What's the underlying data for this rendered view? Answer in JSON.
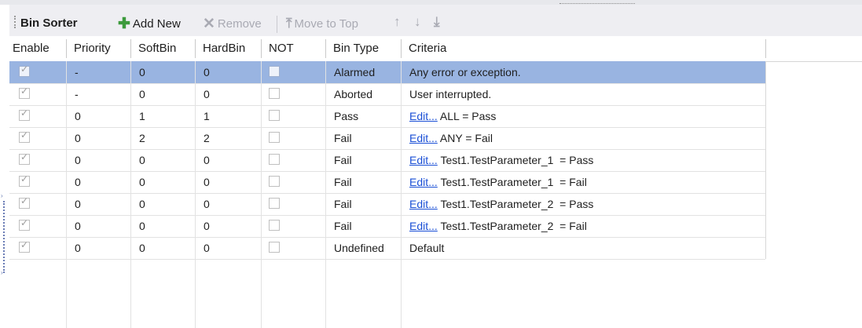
{
  "toolbar": {
    "title": "Bin Sorter",
    "add_new": "Add New",
    "remove": "Remove",
    "move_to_top": "Move to Top",
    "icons": [
      "plus-icon",
      "remove-x-icon",
      "move-to-top-icon",
      "move-up-icon",
      "move-down-icon",
      "move-to-bottom-icon"
    ]
  },
  "table": {
    "columns": [
      "Enable",
      "Priority",
      "SoftBin",
      "HardBin",
      "NOT",
      "Bin Type",
      "Criteria"
    ],
    "rows": [
      {
        "enable": true,
        "priority": "-",
        "softbin": "0",
        "hardbin": "0",
        "not": false,
        "bin_type": "Alarmed",
        "link": "",
        "criteria": "Any error or exception.",
        "selected": true
      },
      {
        "enable": true,
        "priority": "-",
        "softbin": "0",
        "hardbin": "0",
        "not": false,
        "bin_type": "Aborted",
        "link": "",
        "criteria": "User interrupted.",
        "selected": false
      },
      {
        "enable": true,
        "priority": "0",
        "softbin": "1",
        "hardbin": "1",
        "not": false,
        "bin_type": "Pass",
        "link": "Edit...",
        "criteria": "ALL = Pass",
        "selected": false
      },
      {
        "enable": true,
        "priority": "0",
        "softbin": "2",
        "hardbin": "2",
        "not": false,
        "bin_type": "Fail",
        "link": "Edit...",
        "criteria": "ANY = Fail",
        "selected": false
      },
      {
        "enable": true,
        "priority": "0",
        "softbin": "0",
        "hardbin": "0",
        "not": false,
        "bin_type": "Fail",
        "link": "Edit...",
        "criteria": "Test1.TestParameter_1  = Pass",
        "selected": false
      },
      {
        "enable": true,
        "priority": "0",
        "softbin": "0",
        "hardbin": "0",
        "not": false,
        "bin_type": "Fail",
        "link": "Edit...",
        "criteria": "Test1.TestParameter_1  = Fail",
        "selected": false
      },
      {
        "enable": true,
        "priority": "0",
        "softbin": "0",
        "hardbin": "0",
        "not": false,
        "bin_type": "Fail",
        "link": "Edit...",
        "criteria": "Test1.TestParameter_2  = Pass",
        "selected": false
      },
      {
        "enable": true,
        "priority": "0",
        "softbin": "0",
        "hardbin": "0",
        "not": false,
        "bin_type": "Fail",
        "link": "Edit...",
        "criteria": "Test1.TestParameter_2  = Fail",
        "selected": false
      },
      {
        "enable": true,
        "priority": "0",
        "softbin": "0",
        "hardbin": "0",
        "not": false,
        "bin_type": "Undefined",
        "link": "",
        "criteria": "Default",
        "selected": false
      }
    ]
  },
  "colors": {
    "selection": "#99b4e1",
    "link": "#1a4fd6",
    "add_icon": "#3c9a3c",
    "disabled": "#a9aab3"
  }
}
